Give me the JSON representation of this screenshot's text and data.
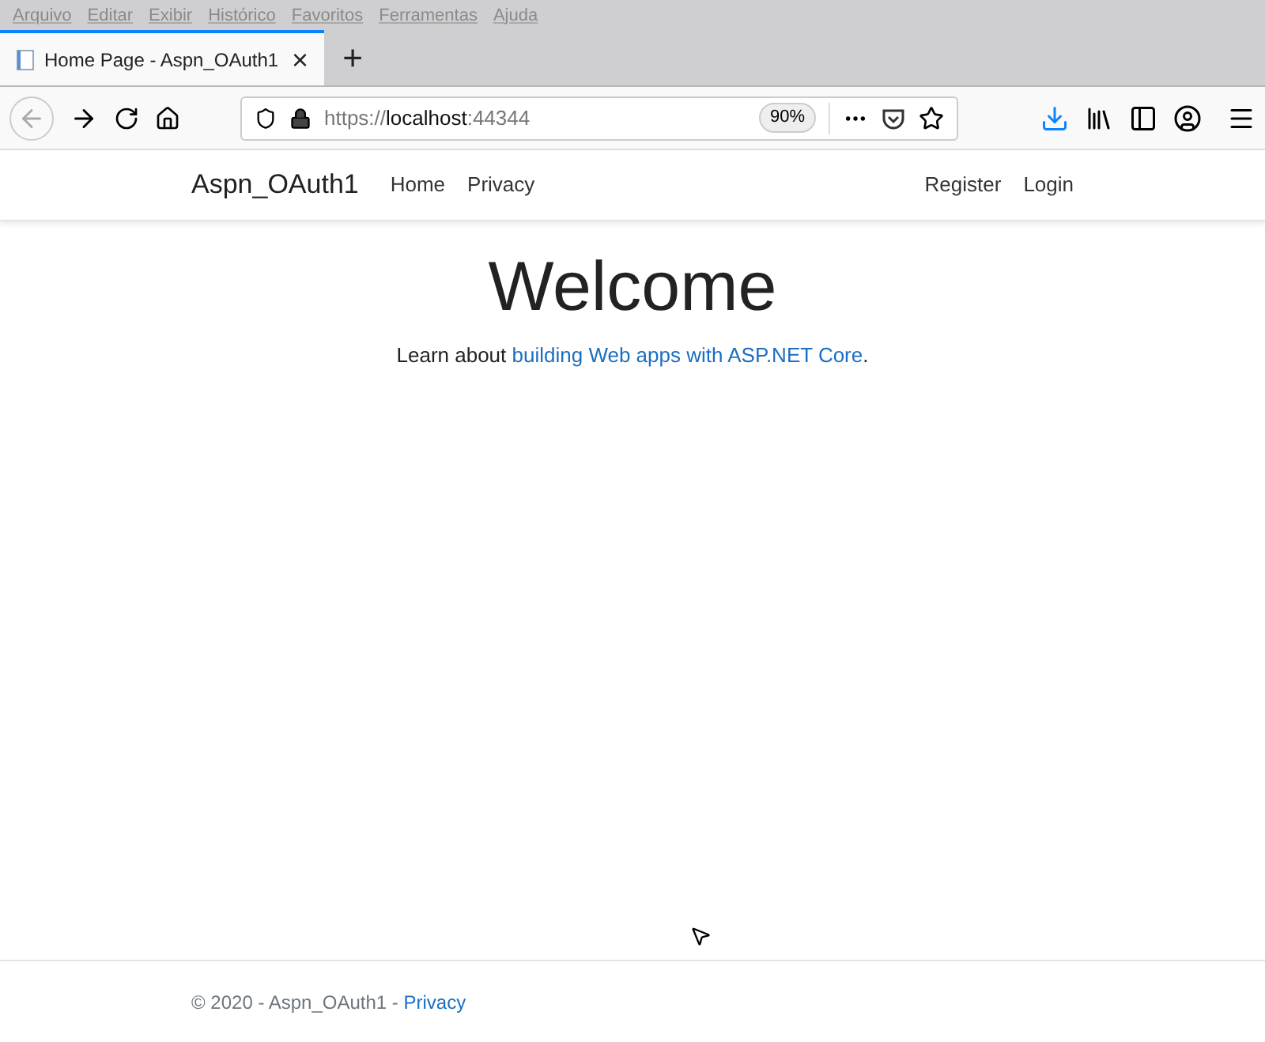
{
  "menu_bar": [
    "Arquivo",
    "Editar",
    "Exibir",
    "Histórico",
    "Favoritos",
    "Ferramentas",
    "Ajuda"
  ],
  "tabs": [
    {
      "label": "Home Page - Aspn_OAuth1",
      "close": "×",
      "selected": true
    }
  ],
  "new_tab": "+",
  "address_bar": {
    "scheme": "https://",
    "host": "localhost",
    "port": ":44344",
    "zoom": "90%"
  },
  "navbar": {
    "brand": "Aspn_OAuth1",
    "left_links": [
      "Home",
      "Privacy"
    ],
    "right_links": [
      "Register",
      "Login"
    ]
  },
  "main": {
    "heading": "Welcome",
    "text_before": "Learn about ",
    "link": "building Web apps with ASP.NET Core",
    "text_after": "."
  },
  "footer": {
    "text": "© 2020 - Aspn_OAuth1 - ",
    "link": "Privacy"
  }
}
